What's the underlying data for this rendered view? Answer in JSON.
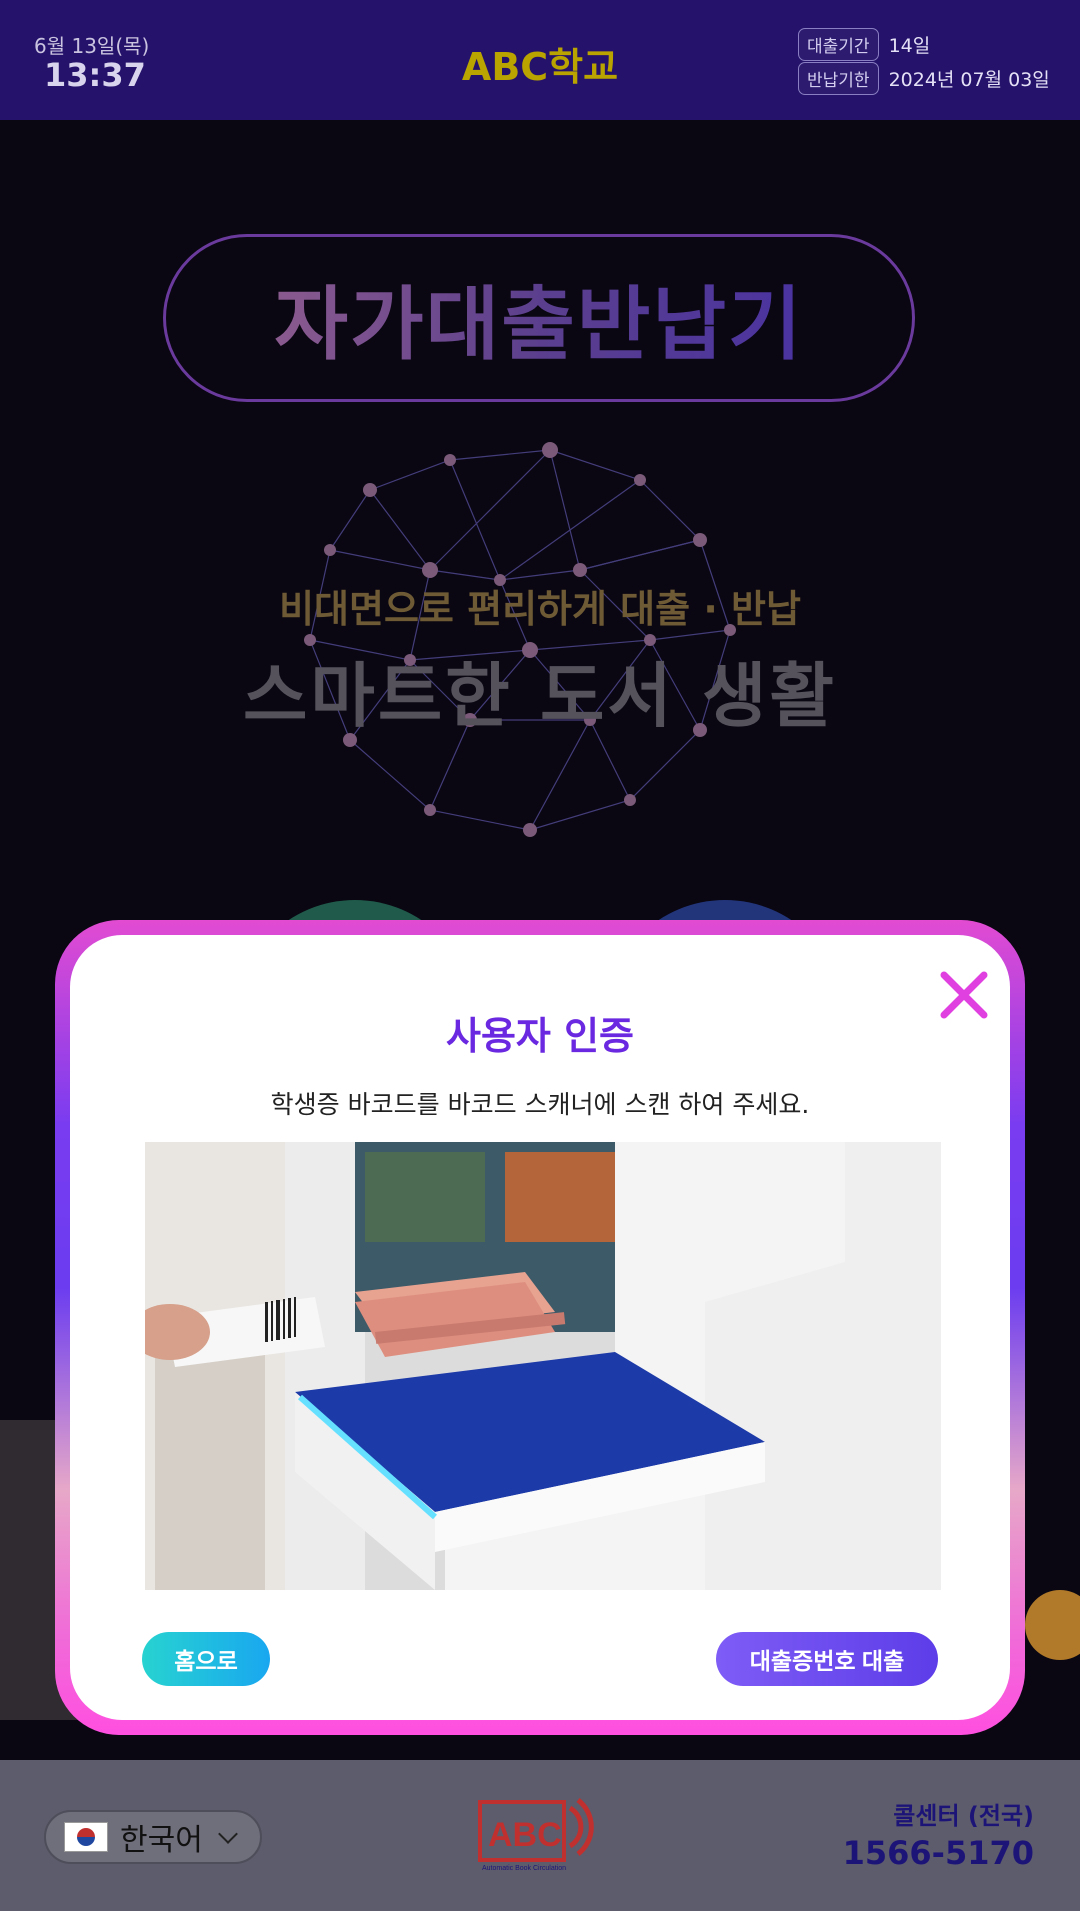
{
  "header": {
    "date": "6월 13일(목)",
    "time": "13:37",
    "school_name": "ABC학교",
    "loan_period_label": "대출기간",
    "loan_period_value": "14일",
    "due_date_label": "반납기한",
    "due_date_value": "2024년 07월 03일"
  },
  "hero": {
    "title": "자가대출반납기",
    "subtitle": "비대면으로 편리하게 대출 · 반납",
    "tagline": "스마트한 도서 생활"
  },
  "modal": {
    "title": "사용자 인증",
    "description": "학생증 바코드를 바코드 스캐너에 스캔 하여 주세요.",
    "home_button": "홈으로",
    "card_number_button": "대출증번호 대출",
    "close_icon": "close-icon"
  },
  "footer": {
    "language": "한국어",
    "logo_text": "ABC",
    "logo_caption": "Automatic Book Circulation",
    "call_center_label": "콜센터 (전국)",
    "call_center_number": "1566-5170"
  },
  "colors": {
    "header_bg": "#25126a",
    "modal_accent": "#6a28e0",
    "close_icon": "#e040e0",
    "home_button": "#1fb8e0",
    "card_button": "#6b4af0"
  }
}
